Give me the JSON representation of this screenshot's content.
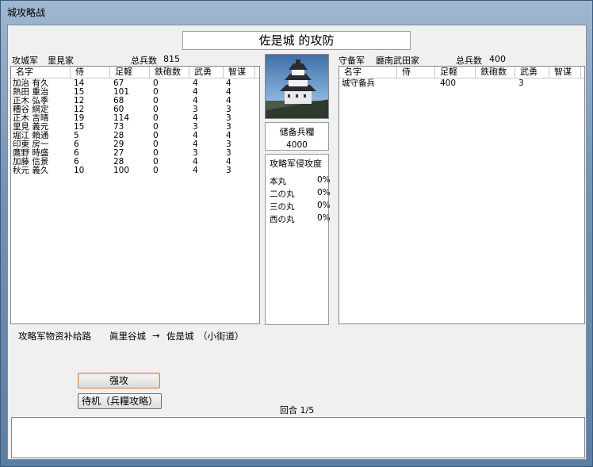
{
  "window_title": "城攻略战",
  "battle_title": "佐是城 的攻防",
  "attacker": {
    "label": "攻城军",
    "clan": "里見家",
    "total_label": "总兵数",
    "total": "815",
    "columns": [
      "名字",
      "侍",
      "足軽",
      "鉄砲数",
      "武勇",
      "智谋"
    ],
    "rows": [
      [
        "加治 有久",
        "14",
        "67",
        "0",
        "4",
        "4"
      ],
      [
        "熱田 重治",
        "15",
        "101",
        "0",
        "4",
        "4"
      ],
      [
        "正木 弘季",
        "12",
        "68",
        "0",
        "4",
        "4"
      ],
      [
        "糟谷 綱定",
        "12",
        "60",
        "0",
        "3",
        "3"
      ],
      [
        "正木 吉晴",
        "19",
        "114",
        "0",
        "4",
        "3"
      ],
      [
        "里見 義元",
        "15",
        "73",
        "0",
        "3",
        "3"
      ],
      [
        "堀江 賴通",
        "5",
        "28",
        "0",
        "4",
        "4"
      ],
      [
        "印東 房一",
        "6",
        "29",
        "0",
        "4",
        "3"
      ],
      [
        "鷹野 時盛",
        "6",
        "27",
        "0",
        "3",
        "3"
      ],
      [
        "加藤 信景",
        "6",
        "28",
        "0",
        "4",
        "4"
      ],
      [
        "秋元 義久",
        "10",
        "100",
        "0",
        "4",
        "3"
      ]
    ]
  },
  "defender": {
    "label": "守备军",
    "clan": "廳南武田家",
    "total_label": "总兵数",
    "total": "400",
    "columns": [
      "名字",
      "侍",
      "足軽",
      "鉄砲数",
      "武勇",
      "智谋"
    ],
    "rows": [
      [
        "城守备兵",
        "",
        "400",
        "",
        "3",
        ""
      ]
    ]
  },
  "stock": {
    "label": "储备兵糧",
    "value": "4000"
  },
  "invasion": {
    "label": "攻略军侵攻度",
    "items": [
      {
        "name": "本丸",
        "value": "0%"
      },
      {
        "name": "二の丸",
        "value": "0%"
      },
      {
        "name": "三の丸",
        "value": "0%"
      },
      {
        "name": "西の丸",
        "value": "0%"
      }
    ]
  },
  "supply": {
    "label": "攻略军物资补给路",
    "from": "眞里谷城",
    "arrow": "→",
    "to": "佐是城",
    "route": "（小街道）"
  },
  "buttons": {
    "assault": "强攻",
    "wait": "待机（兵糧攻略）"
  },
  "turn": "回合 1/5"
}
